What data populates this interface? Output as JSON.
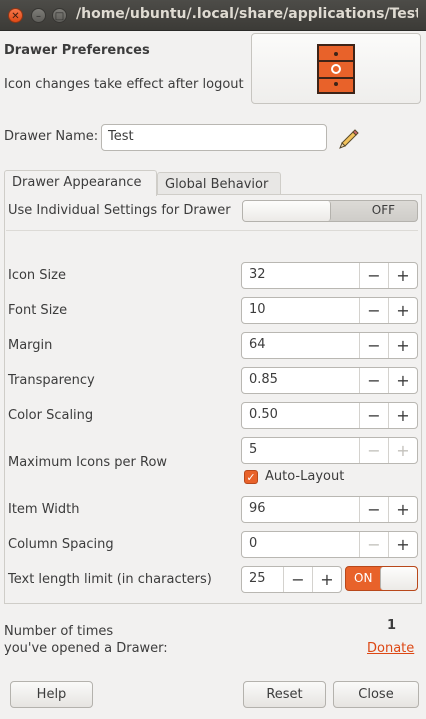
{
  "window": {
    "title": "/home/ubuntu/.local/share/applications/Test",
    "close_glyph": "✕",
    "min_glyph": "–",
    "max_glyph": "□"
  },
  "header": {
    "title": "Drawer Preferences",
    "subtitle": "Icon changes take effect after logout",
    "icon": "drawer-cabinet-icon"
  },
  "drawer_name": {
    "label": "Drawer Name:",
    "value": "Test",
    "edit_icon": "pencil-icon"
  },
  "tabs": [
    {
      "label": "Drawer Appearance",
      "active": true
    },
    {
      "label": "Global Behavior",
      "active": false
    }
  ],
  "individual_settings": {
    "label": "Use Individual Settings for Drawer",
    "state": "OFF"
  },
  "settings": {
    "icon_size": {
      "label": "Icon Size",
      "value": "32"
    },
    "font_size": {
      "label": "Font Size",
      "value": "10"
    },
    "margin": {
      "label": "Margin",
      "value": "64"
    },
    "transparency": {
      "label": "Transparency",
      "value": "0.85"
    },
    "color_scaling": {
      "label": "Color Scaling",
      "value": "0.50"
    },
    "max_icons": {
      "label": "Maximum Icons per Row",
      "value": "5"
    },
    "auto_layout": {
      "label": "Auto-Layout",
      "checked": true
    },
    "item_width": {
      "label": "Item Width",
      "value": "96"
    },
    "column_spacing": {
      "label": "Column Spacing",
      "value": "0"
    },
    "text_length": {
      "label": "Text length limit (in characters)",
      "value": "25",
      "toggle_state": "ON"
    }
  },
  "spin_glyphs": {
    "minus": "−",
    "plus": "+"
  },
  "stats": {
    "label_line1": "Number of times",
    "label_line2": "you've opened a Drawer:",
    "count": "1",
    "donate": "Donate"
  },
  "buttons": {
    "help": "Help",
    "reset": "Reset",
    "close": "Close"
  },
  "colors": {
    "accent": "#e8622a",
    "link": "#dd4814",
    "titlebar": "#3c3b37",
    "background": "#f2f1f0"
  }
}
